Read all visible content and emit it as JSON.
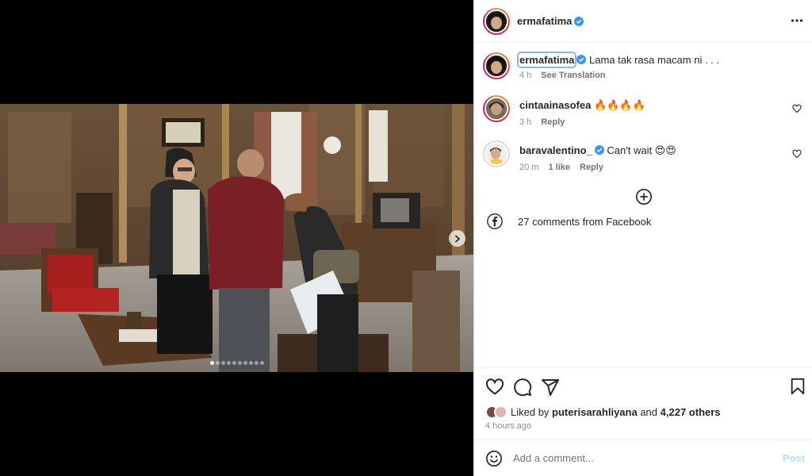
{
  "post": {
    "author": "ermafatima",
    "caption": "Lama tak rasa macam ni . . .",
    "caption_time": "4 h",
    "see_translation": "See Translation",
    "carousel_count": 10,
    "carousel_active": 0
  },
  "comments": [
    {
      "user": "cintaainasofea",
      "text": "🔥🔥🔥🔥",
      "time": "3 h",
      "likes": "",
      "reply": "Reply",
      "verified": false
    },
    {
      "user": "baravalentino_",
      "text": "Can't wait 😍😍",
      "time": "20 m",
      "likes": "1 like",
      "reply": "Reply",
      "verified": true
    }
  ],
  "facebook_comments": "27 comments from Facebook",
  "likes": {
    "prefix": "Liked by",
    "user": "puterisarahliyana",
    "and": "and",
    "others": "4,227 others"
  },
  "posted_ago": "4 hours ago",
  "comment_box": {
    "placeholder": "Add a comment...",
    "post_label": "Post"
  },
  "colors": {
    "verified": "#3897f0",
    "post_disabled": "#b2dffc",
    "secondary_text": "#8e8e8e"
  },
  "icons": [
    "more-options-icon",
    "heart-icon",
    "comment-icon",
    "share-icon",
    "bookmark-icon",
    "plus-circle-icon",
    "facebook-icon",
    "emoji-icon",
    "chevron-right-icon",
    "verified-icon"
  ]
}
